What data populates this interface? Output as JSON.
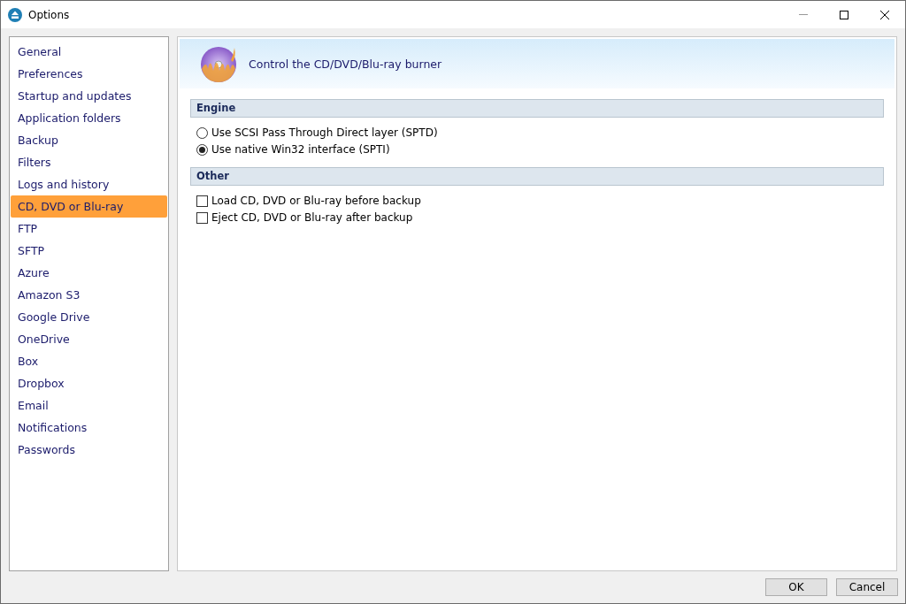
{
  "window": {
    "title": "Options"
  },
  "sidebar": {
    "items": [
      {
        "label": "General",
        "selected": false
      },
      {
        "label": "Preferences",
        "selected": false
      },
      {
        "label": "Startup and updates",
        "selected": false
      },
      {
        "label": "Application folders",
        "selected": false
      },
      {
        "label": "Backup",
        "selected": false
      },
      {
        "label": "Filters",
        "selected": false
      },
      {
        "label": "Logs and history",
        "selected": false
      },
      {
        "label": "CD, DVD or Blu-ray",
        "selected": true
      },
      {
        "label": "FTP",
        "selected": false
      },
      {
        "label": "SFTP",
        "selected": false
      },
      {
        "label": "Azure",
        "selected": false
      },
      {
        "label": "Amazon S3",
        "selected": false
      },
      {
        "label": "Google Drive",
        "selected": false
      },
      {
        "label": "OneDrive",
        "selected": false
      },
      {
        "label": "Box",
        "selected": false
      },
      {
        "label": "Dropbox",
        "selected": false
      },
      {
        "label": "Email",
        "selected": false
      },
      {
        "label": "Notifications",
        "selected": false
      },
      {
        "label": "Passwords",
        "selected": false
      }
    ]
  },
  "panel": {
    "heading": "Control the CD/DVD/Blu-ray burner",
    "sections": [
      {
        "title": "Engine",
        "options": [
          {
            "kind": "radio",
            "label": "Use SCSI Pass Through Direct layer (SPTD)",
            "selected": false
          },
          {
            "kind": "radio",
            "label": "Use native Win32 interface (SPTI)",
            "selected": true
          }
        ]
      },
      {
        "title": "Other",
        "options": [
          {
            "kind": "checkbox",
            "label": "Load CD, DVD or Blu-ray before backup",
            "checked": false
          },
          {
            "kind": "checkbox",
            "label": "Eject CD, DVD or Blu-ray after backup",
            "checked": false
          }
        ]
      }
    ]
  },
  "buttons": [
    "OK",
    "Cancel"
  ]
}
